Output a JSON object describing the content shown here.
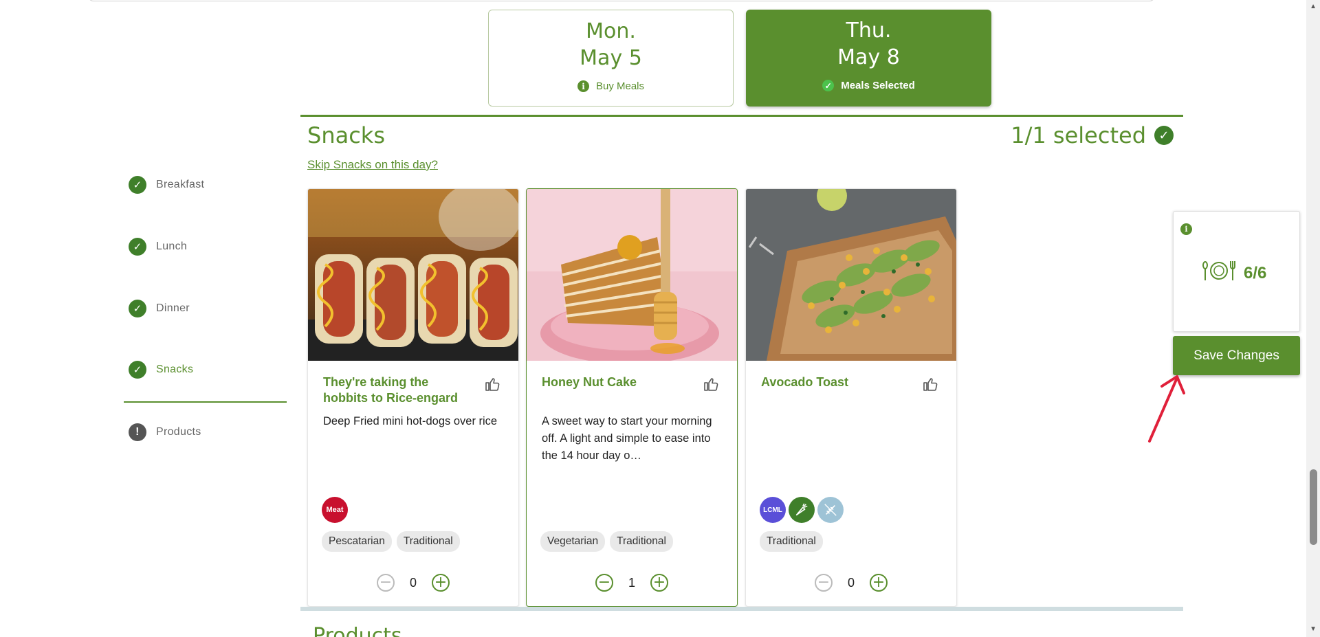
{
  "days": [
    {
      "dow": "Mon.",
      "date": "May 5",
      "status": "Buy Meals",
      "active": false
    },
    {
      "dow": "Thu.",
      "date": "May 8",
      "status": "Meals Selected",
      "active": true
    }
  ],
  "section": {
    "title": "Snacks",
    "selected_count": "1/1 selected",
    "skip_link": "Skip Snacks on this day?",
    "next_heading": "Products"
  },
  "sidebar": {
    "items": [
      {
        "label": "Breakfast",
        "state": "done"
      },
      {
        "label": "Lunch",
        "state": "done"
      },
      {
        "label": "Dinner",
        "state": "done"
      },
      {
        "label": "Snacks",
        "state": "done"
      },
      {
        "label": "Products",
        "state": "warning"
      }
    ]
  },
  "cards": [
    {
      "title": "They're taking the hobbits to Rice-engard",
      "description": "Deep Fried mini hot-dogs over rice",
      "badges": [
        {
          "label": "Meat",
          "color": "#c8102e"
        }
      ],
      "tags": [
        "Pescatarian",
        "Traditional"
      ],
      "quantity": "0"
    },
    {
      "title": "Honey Nut Cake",
      "description": "A sweet way to start your morning off. A light and simple to ease into the 14 hour day o…",
      "badges": [],
      "tags": [
        "Vegetarian",
        "Traditional"
      ],
      "quantity": "1"
    },
    {
      "title": "Avocado Toast",
      "description": "",
      "badges": [
        {
          "label": "LCML",
          "color": "#5a4fd8"
        },
        {
          "label": "carrot-icon",
          "color": "#3f7f2a"
        },
        {
          "label": "wheat-icon",
          "color": "#9ec3d6"
        }
      ],
      "tags": [
        "Traditional"
      ],
      "quantity": "0"
    }
  ],
  "widget": {
    "meal_count": "6/6",
    "save_label": "Save Changes"
  },
  "colors": {
    "brand_green": "#5a8f2e",
    "dark_check": "#3f7f2a",
    "annotation_arrow": "#e0203a"
  }
}
